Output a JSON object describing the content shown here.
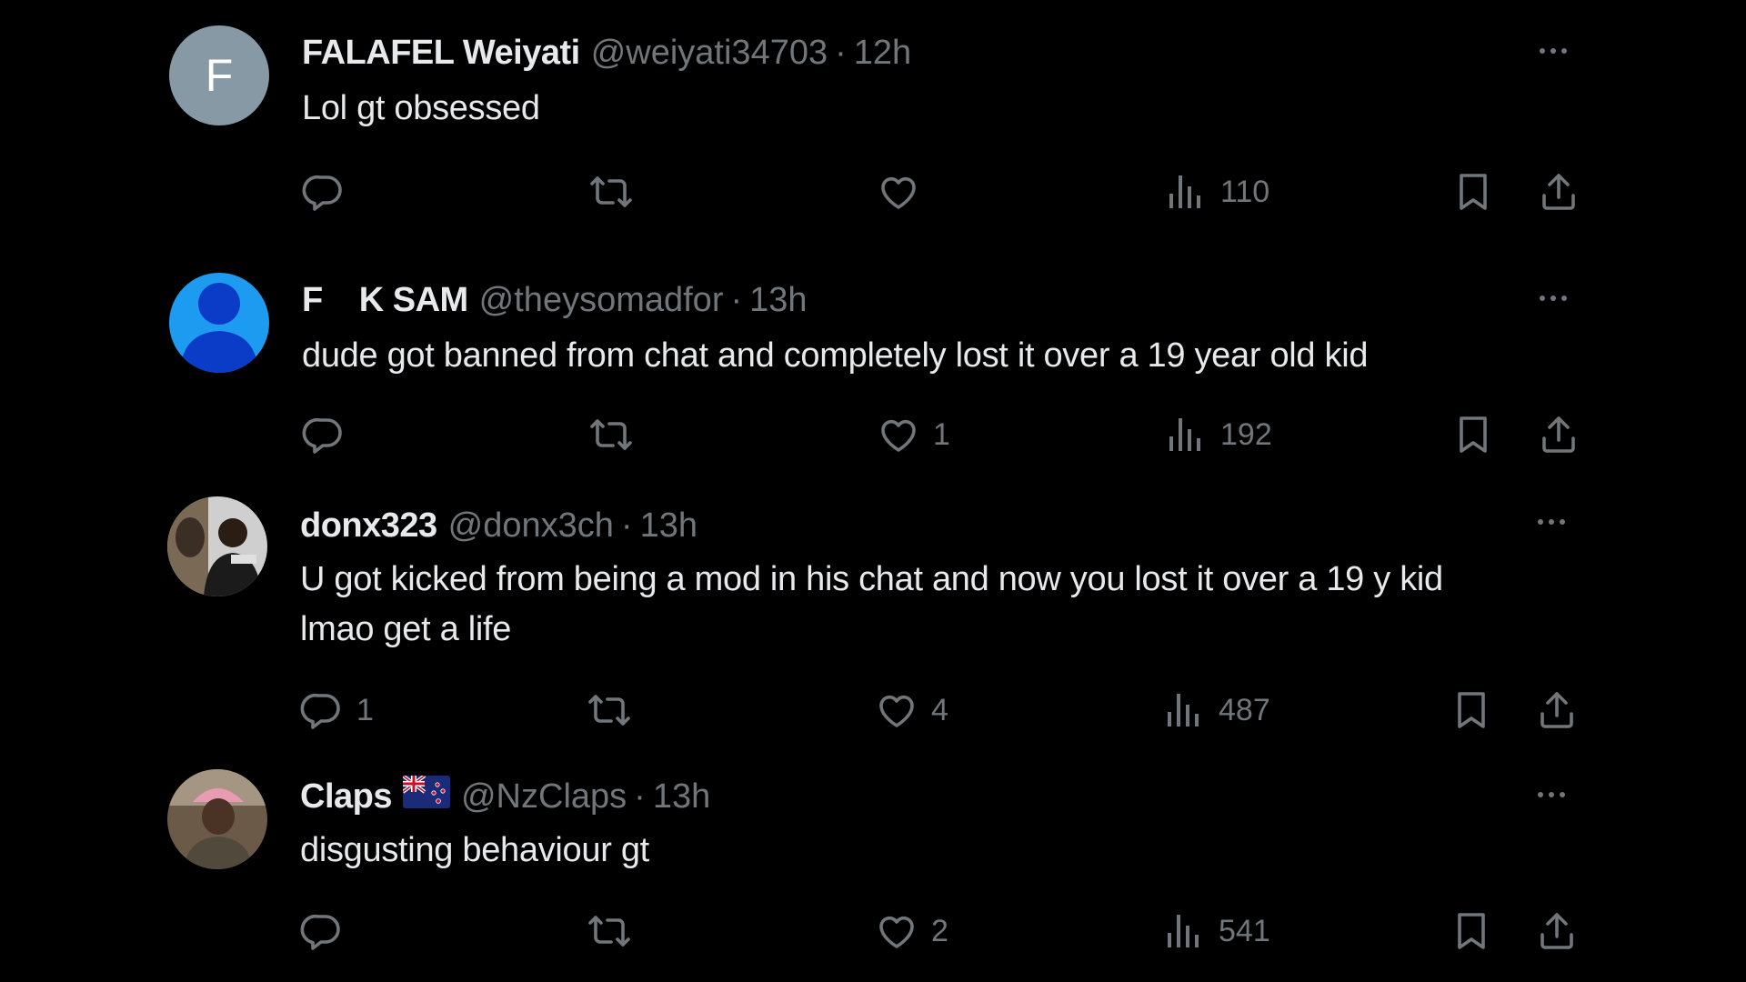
{
  "colors": {
    "background": "#000000",
    "primary_text": "#e7e9ea",
    "secondary_text": "#71767b"
  },
  "replies": [
    {
      "avatar_icon": "letter-avatar",
      "avatar_letter": "F",
      "display_name": "FALAFEL Weiyati",
      "handle": "@weiyati34703",
      "separator": "·",
      "time": "12h",
      "text": "Lol gt obsessed",
      "replies_count": "",
      "retweets_count": "",
      "likes_count": "",
      "views_count": "110"
    },
    {
      "avatar_icon": "default-user-avatar",
      "display_name_part1": "F",
      "display_name_part2": "K SAM",
      "handle": "@theysomadfor",
      "separator": "·",
      "time": "13h",
      "text": "dude got banned from chat and completely lost it over a 19 year old kid",
      "replies_count": "",
      "retweets_count": "",
      "likes_count": "1",
      "views_count": "192"
    },
    {
      "avatar_icon": "photo-avatar",
      "display_name": "donx323",
      "handle": "@donx3ch",
      "separator": "·",
      "time": "13h",
      "text_line1": "U got kicked from being a mod in his chat and now you lost it over a 19 y kid",
      "text_line2": "lmao get a life",
      "replies_count": "1",
      "retweets_count": "",
      "likes_count": "4",
      "views_count": "487"
    },
    {
      "avatar_icon": "photo-avatar",
      "display_name": "Claps",
      "flag_icon": "new-zealand-flag-icon",
      "handle": "@NzClaps",
      "separator": "·",
      "time": "13h",
      "text": "disgusting behaviour gt",
      "replies_count": "",
      "retweets_count": "",
      "likes_count": "2",
      "views_count": "541"
    }
  ]
}
